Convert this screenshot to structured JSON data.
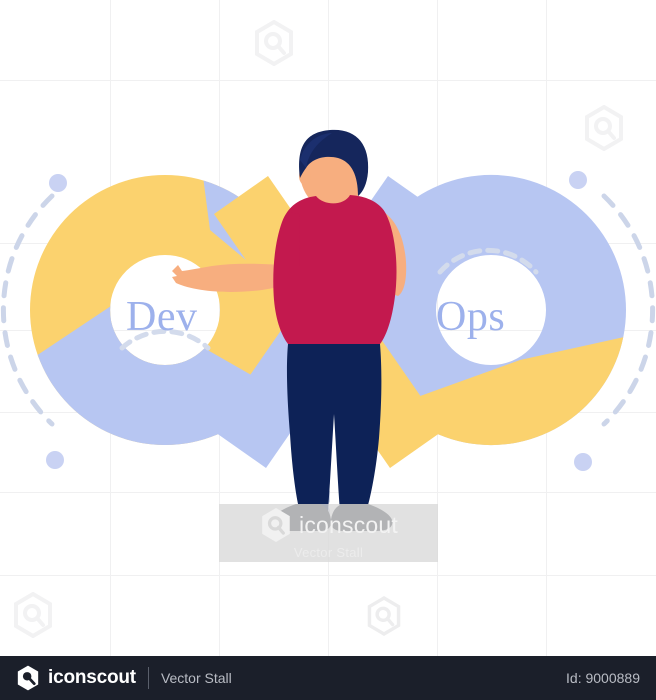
{
  "illustration": {
    "title": "DevOps infinity loop with standing man",
    "loop": {
      "left_label": "Dev",
      "right_label": "Ops",
      "color_yellow": "#FBD26E",
      "color_blue": "#B7C6F2",
      "label_color": "#9DB1EC",
      "dash_color": "#C9D2E8"
    },
    "character": {
      "hair_color": "#15265C",
      "skin_color": "#F7AE7F",
      "shirt_color": "#C3194E",
      "pants_color": "#0D2257",
      "shoes_color": "#2B3038"
    },
    "background": {
      "page_color": "#FFFFFF",
      "grid_color": "#F0F0F1",
      "dot_color": "#C9D2F3",
      "watermark_color": "#F4F4F5"
    }
  },
  "watermark": {
    "brand": "iconscout",
    "author": "Vector Stall",
    "icon": "iconscout-hex-icon",
    "band_color": "#D9D9D9"
  },
  "footer": {
    "brand": "iconscout",
    "author": "Vector Stall",
    "id_label": "Id: 9000889",
    "background": "#1B1F2A",
    "logo_icon": "iconscout-hex-icon"
  }
}
